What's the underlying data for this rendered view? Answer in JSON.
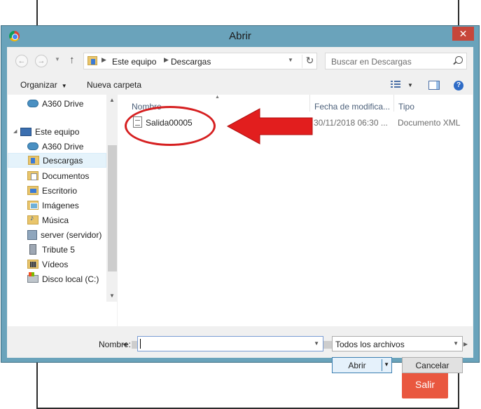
{
  "background_page": {
    "salir_label": "Salir",
    "salir_color": "#e9573f"
  },
  "dialog": {
    "title": "Abrir",
    "close_glyph": "✕",
    "frame_color": "#6aa3bb"
  },
  "nav": {
    "back_glyph": "←",
    "forward_glyph": "→",
    "up_glyph": "↑",
    "breadcrumb": [
      "Este equipo",
      "Descargas"
    ],
    "refresh_glyph": "↻",
    "search_placeholder": "Buscar en Descargas"
  },
  "toolbar": {
    "organize_label": "Organizar",
    "new_folder_label": "Nueva carpeta",
    "help_glyph": "?"
  },
  "sidebar": {
    "items": [
      {
        "label": "A360 Drive",
        "icon": "cloud-icon"
      },
      {
        "label": "Este equipo",
        "icon": "computer-icon"
      },
      {
        "label": "A360 Drive",
        "icon": "cloud-icon"
      },
      {
        "label": "Descargas",
        "icon": "downloads-folder-icon",
        "selected": true
      },
      {
        "label": "Documentos",
        "icon": "documents-folder-icon"
      },
      {
        "label": "Escritorio",
        "icon": "desktop-folder-icon"
      },
      {
        "label": "Imágenes",
        "icon": "pictures-folder-icon"
      },
      {
        "label": "Música",
        "icon": "music-folder-icon"
      },
      {
        "label": "server (servidor)",
        "icon": "network-drive-icon"
      },
      {
        "label": "Tribute 5",
        "icon": "device-icon"
      },
      {
        "label": "Vídeos",
        "icon": "videos-folder-icon"
      },
      {
        "label": "Disco local (C:)",
        "icon": "local-disk-icon"
      }
    ]
  },
  "filelist": {
    "columns": [
      "Nombre",
      "Fecha de modifica...",
      "Tipo"
    ],
    "rows": [
      {
        "name": "Salida00005",
        "date": "30/11/2018 06:30 ...",
        "type": "Documento XML"
      }
    ],
    "annotation_color": "#d62021"
  },
  "footer": {
    "filename_label": "Nombre:",
    "filename_value": "",
    "filetype_value": "Todos los archivos",
    "open_label": "Abrir",
    "cancel_label": "Cancelar"
  }
}
